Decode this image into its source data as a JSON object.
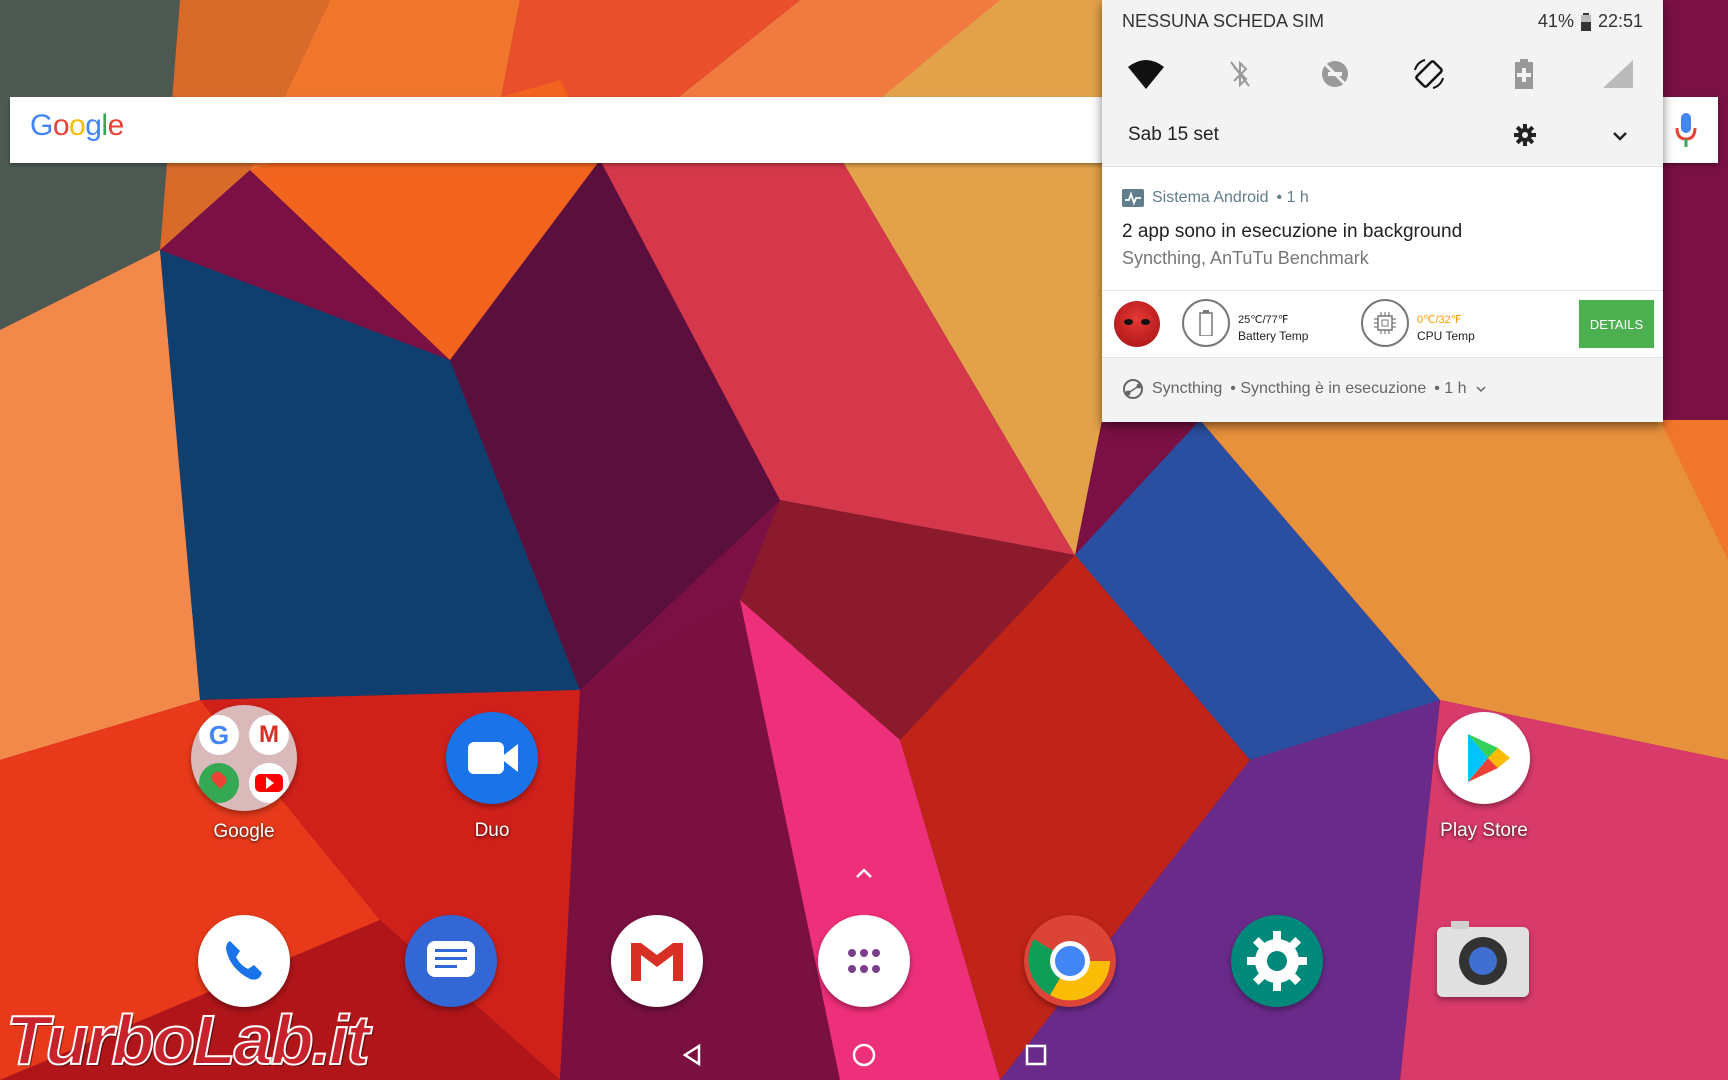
{
  "status_bar": {
    "carrier": "NESSUNA SCHEDA SIM",
    "battery": "41%",
    "time": "22:51"
  },
  "quick_settings": {
    "tiles": [
      "wifi-icon",
      "bluetooth-off-icon",
      "do-not-disturb-off-icon",
      "auto-rotate-icon",
      "battery-saver-icon",
      "cellular-signal-icon"
    ],
    "date": "Sab 15 set"
  },
  "notifications": [
    {
      "app": "Sistema Android",
      "time": "• 1 h",
      "title": "2 app sono in esecuzione in background",
      "text": "Syncthing, AnTuTu Benchmark"
    },
    {
      "battery_temp": "25℃/77℉",
      "battery_label": "Battery Temp",
      "cpu_temp": "0℃/32℉",
      "cpu_label": "CPU Temp",
      "details_label": "DETAILS"
    },
    {
      "app": "Syncthing",
      "text": "• Syncthing è in esecuzione",
      "time": "• 1 h"
    }
  ],
  "search_bar": {
    "logo": [
      "G",
      "o",
      "o",
      "g",
      "l",
      "e"
    ],
    "logo_colors": [
      "#4285F4",
      "#EA4335",
      "#FBBC05",
      "#4285F4",
      "#34A853",
      "#EA4335"
    ]
  },
  "home_apps": [
    {
      "label": "Google"
    },
    {
      "label": "Duo"
    },
    {
      "label": "Play Store"
    }
  ],
  "dock": [
    "phone-icon",
    "messages-icon",
    "gmail-icon",
    "app-drawer-icon",
    "chrome-icon",
    "settings-icon",
    "camera-icon"
  ],
  "navigation": [
    "back-button",
    "home-button",
    "recents-button"
  ],
  "watermark": "TurboLab.it",
  "colors": {
    "details_button": "#4caf50",
    "cpu_temp": "#ff9800",
    "notification_header": "#607d8b"
  }
}
